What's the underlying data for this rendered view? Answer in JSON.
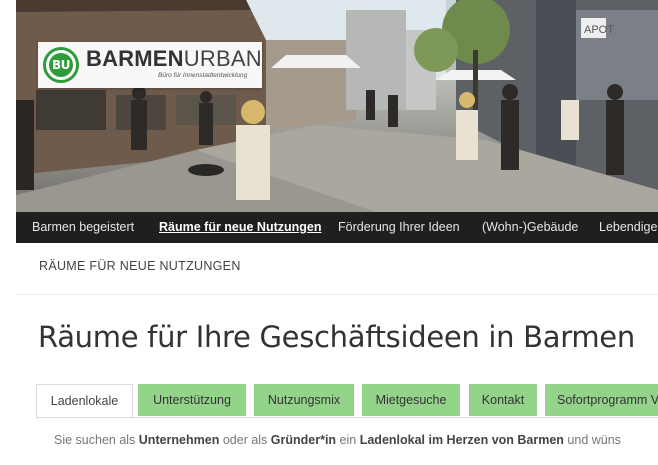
{
  "logo": {
    "badge": "BU",
    "word_bold": "BARMEN",
    "word_light": "URBAN",
    "tagline": "Büro für Innenstadtentwicklung"
  },
  "hero": {
    "shop_sign": "APOT"
  },
  "nav": {
    "items": [
      {
        "label": "Barmen begeistert"
      },
      {
        "label": "Räume für neue Nutzungen",
        "active": true
      },
      {
        "label": "Förderung Ihrer Ideen"
      },
      {
        "label": "(Wohn-)Gebäude"
      },
      {
        "label": "Lebendige"
      }
    ]
  },
  "breadcrumb": "RÄUME FÜR NEUE NUTZUNGEN",
  "page_title": "Räume für Ihre Geschäftsideen in Barmen",
  "tabs": [
    {
      "label": "Ladenlokale",
      "active": true
    },
    {
      "label": "Unterstützung"
    },
    {
      "label": "Nutzungsmix"
    },
    {
      "label": "Mietgesuche"
    },
    {
      "label": "Kontakt"
    },
    {
      "label": "Sofortprogramm V"
    }
  ],
  "intro": {
    "t1": "Sie suchen als ",
    "b1": "Unternehmen",
    "t2": " oder als ",
    "b2": "Gründer*in",
    "t3": " ein ",
    "b3": "Ladenlokal im Herzen von Barmen",
    "t4": " und wüns"
  },
  "colors": {
    "accent_green": "#2e9c3a",
    "tab_green": "#93d38a",
    "nav_bg": "#1f1f1f",
    "text_dark": "#333333"
  }
}
